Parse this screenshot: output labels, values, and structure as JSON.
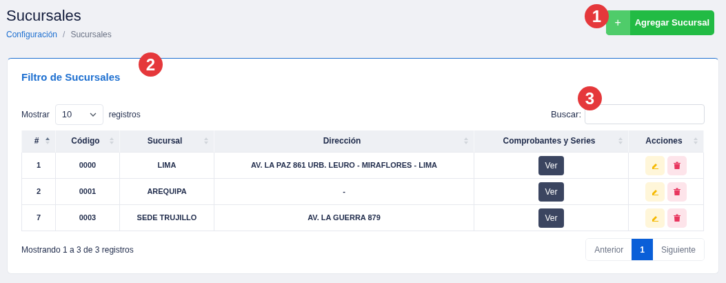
{
  "page": {
    "title": "Sucursales",
    "breadcrumb": [
      {
        "label": "Configuración",
        "kind": "link"
      },
      {
        "label": "/",
        "kind": "separator"
      },
      {
        "label": "Sucursales",
        "kind": "current"
      }
    ],
    "add_button": {
      "icon": "+",
      "label": "Agregar Sucursal",
      "callout": "1"
    }
  },
  "card": {
    "title": "Filtro de Sucursales",
    "title_callout": "2",
    "length_control": {
      "before": "Mostrar",
      "value": "10",
      "after": "registros"
    },
    "search": {
      "label": "Buscar:",
      "callout": "3"
    },
    "table": {
      "columns": [
        {
          "label": "#",
          "sorted": true
        },
        {
          "label": "Código",
          "sorted": false
        },
        {
          "label": "Sucursal",
          "sorted": false
        },
        {
          "label": "Dirección",
          "sorted": false
        },
        {
          "label": "Comprobantes y Series",
          "sorted": false
        },
        {
          "label": "Acciones",
          "sorted": false
        }
      ],
      "rows": [
        {
          "num": "1",
          "code": "0000",
          "name": "LIMA",
          "address": "AV. LA PAZ 861 URB. LEURO - MIRAFLORES - LIMA",
          "view": "Ver"
        },
        {
          "num": "2",
          "code": "0001",
          "name": "AREQUIPA",
          "address": "-",
          "view": "Ver"
        },
        {
          "num": "7",
          "code": "0003",
          "name": "SEDE TRUJILLO",
          "address": "AV. LA GUERRA 879",
          "view": "Ver"
        }
      ]
    },
    "info": "Mostrando 1 a 3 de 3 registros",
    "pagination": [
      {
        "label": "Anterior",
        "selected": false
      },
      {
        "label": "1",
        "selected": true
      },
      {
        "label": "Siguiente",
        "selected": false
      }
    ]
  }
}
